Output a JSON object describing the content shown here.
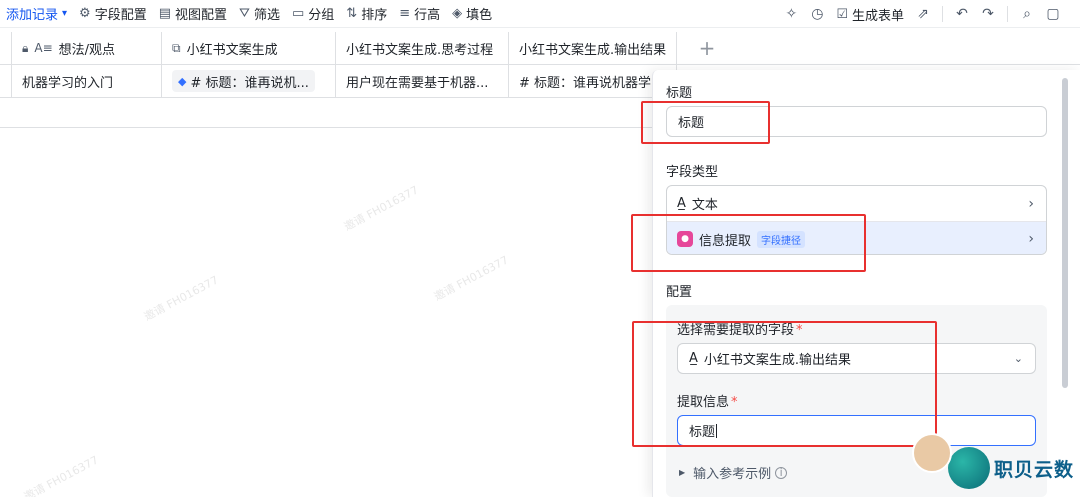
{
  "toolbar": {
    "add_record": "添加记录",
    "field_config": "字段配置",
    "view_config": "视图配置",
    "filter": "筛选",
    "group": "分组",
    "sort": "排序",
    "row_height": "行高",
    "fill_color": "填色",
    "generate_form": "生成表单"
  },
  "grid": {
    "headers": [
      "想法/观点",
      "小红书文案生成",
      "小红书文案生成.思考过程",
      "小红书文案生成.输出结果"
    ],
    "row": [
      "机器学习的入门",
      "# 标题：谁再说机...",
      "用户现在需要基于机器...",
      "# 标题：谁再说机器学"
    ]
  },
  "watermark": "邀请 FH016377",
  "panel": {
    "title_label": "标题",
    "title_value": "标题",
    "field_type_label": "字段类型",
    "type_text": "文本",
    "type_extract": "信息提取",
    "type_extract_badge": "字段捷径",
    "config_label": "配置",
    "select_field_label": "选择需要提取的字段",
    "select_field_value": "小红书文案生成.输出结果",
    "extract_info_label": "提取信息",
    "extract_info_value": "标题",
    "example_label": "输入参考示例"
  },
  "brand": {
    "name": "职贝云数"
  },
  "colors": {
    "accent": "#1456f0",
    "annotation": "#e8302f",
    "selected": "#e8effe"
  }
}
